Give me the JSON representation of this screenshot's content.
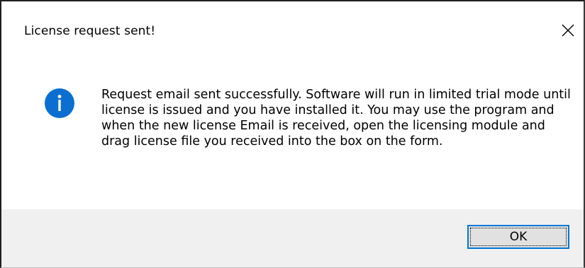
{
  "dialog": {
    "title": "License request sent!",
    "message": "Request email sent successfully. Software will run in limited trial mode until license is issued and you have installed it. You may use the program and when the new license Email is received, open the licensing module and drag license file you received into the box on the form.",
    "icon": "info-icon",
    "ok_label": "OK"
  },
  "colors": {
    "info_icon": "#0a6fd1",
    "button_focus_border": "#0078d7",
    "footer_background": "#f0f0f0"
  }
}
